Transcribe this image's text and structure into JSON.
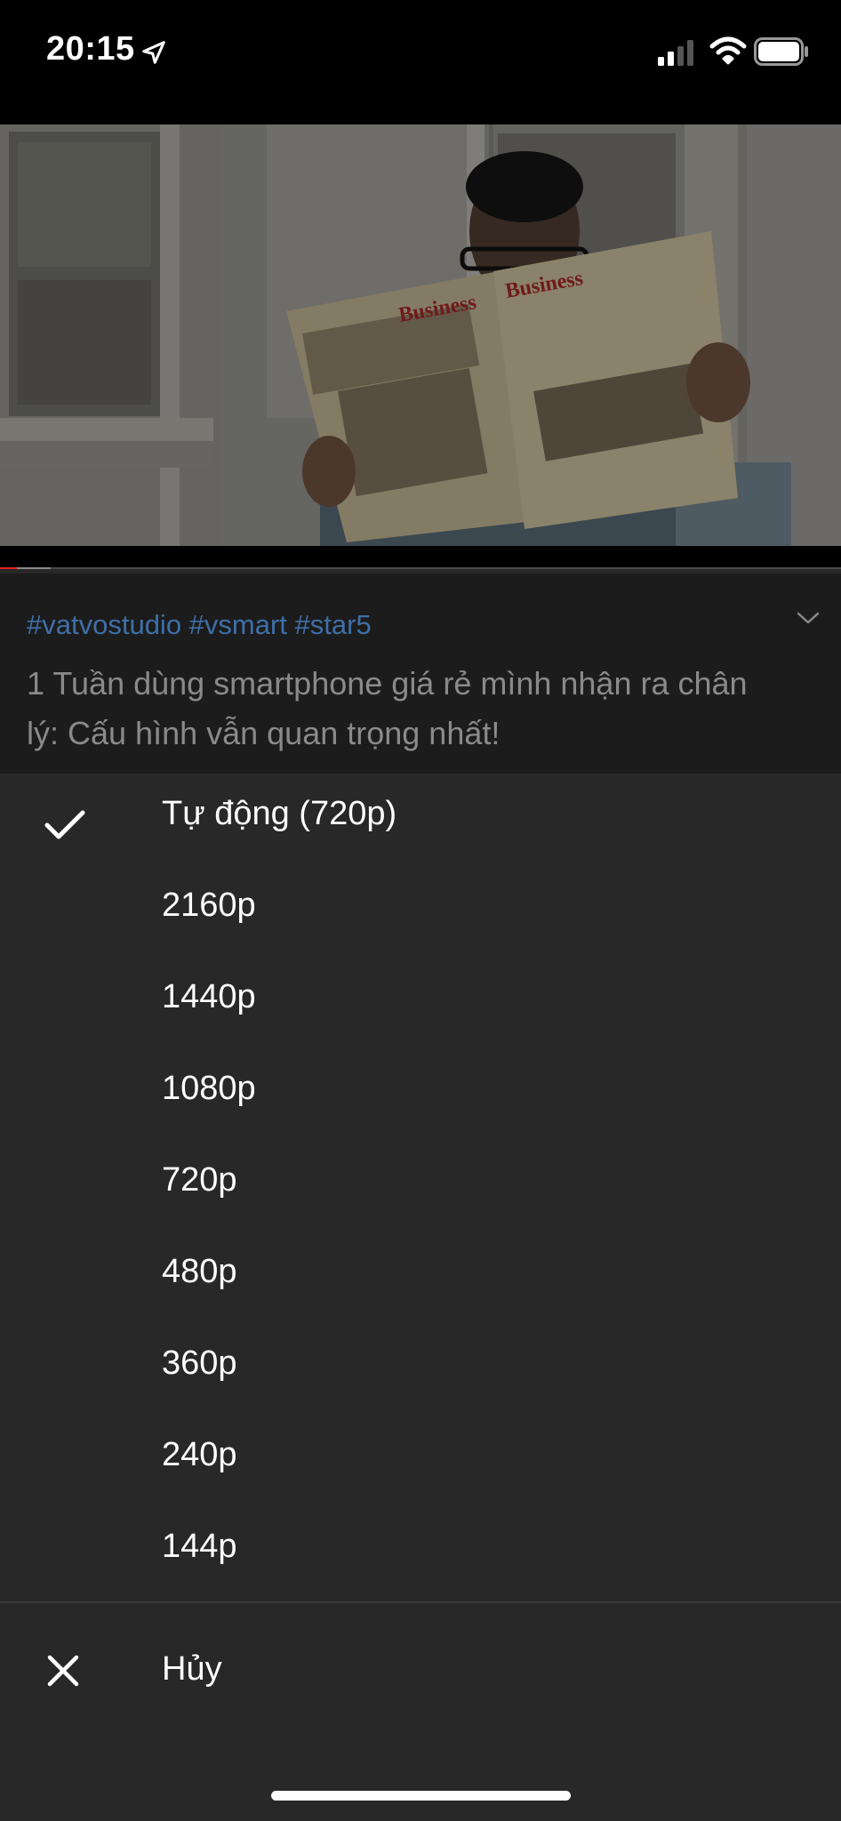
{
  "status_bar": {
    "time": "20:15",
    "icons": [
      "location-arrow-icon",
      "signal-icon",
      "wifi-icon",
      "battery-icon"
    ]
  },
  "video": {
    "progress_played": 0.02,
    "progress_buffered": 0.06,
    "colors": {
      "played": "#e62117",
      "buffered": "#8a8a8a",
      "track": "#4a4a4a"
    }
  },
  "description": {
    "hashtags": "#vatvostudio #vsmart #star5",
    "title": "1 Tuần dùng smartphone giá rẻ mình nhận ra chân lý: Cấu hình vẫn quan trọng nhất!",
    "hashtag_color": "#3e6fa8"
  },
  "quality_menu": {
    "options": [
      {
        "label": "Tự động (720p)",
        "selected": true
      },
      {
        "label": "2160p",
        "selected": false
      },
      {
        "label": "1440p",
        "selected": false
      },
      {
        "label": "1080p",
        "selected": false
      },
      {
        "label": "720p",
        "selected": false
      },
      {
        "label": "480p",
        "selected": false
      },
      {
        "label": "360p",
        "selected": false
      },
      {
        "label": "240p",
        "selected": false
      },
      {
        "label": "144p",
        "selected": false
      }
    ],
    "cancel_label": "Hủy"
  }
}
